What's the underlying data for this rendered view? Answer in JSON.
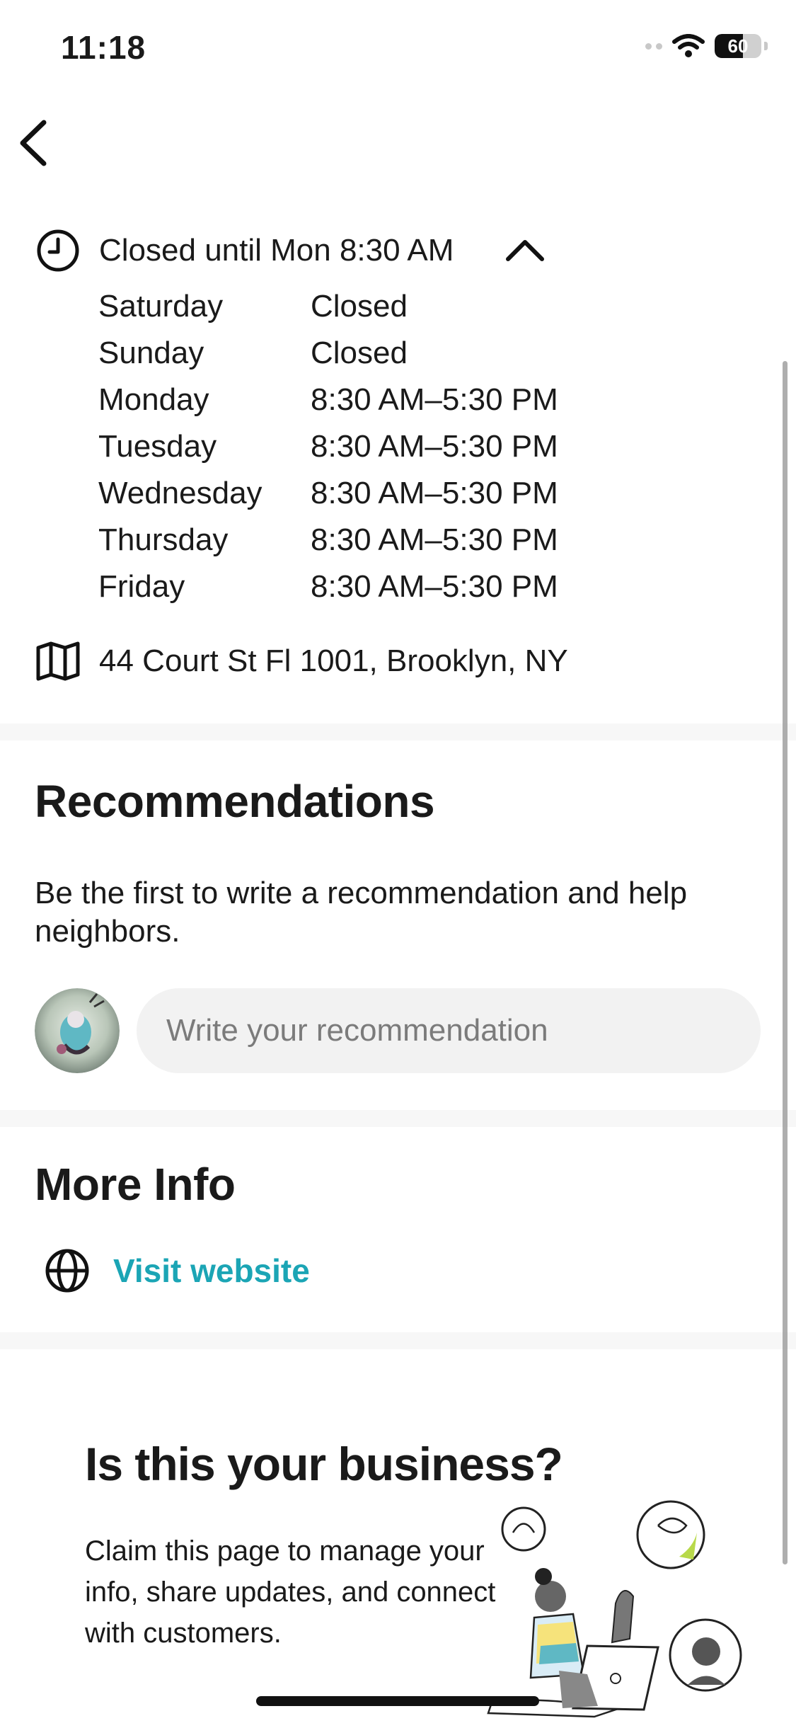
{
  "status": {
    "time": "11:18",
    "battery": "60",
    "battery_level": 0.6
  },
  "hours": {
    "summary": "Closed until Mon 8:30 AM",
    "rows": [
      {
        "day": "Saturday",
        "time": "Closed"
      },
      {
        "day": "Sunday",
        "time": "Closed"
      },
      {
        "day": "Monday",
        "time": "8:30 AM–5:30 PM"
      },
      {
        "day": "Tuesday",
        "time": "8:30 AM–5:30 PM"
      },
      {
        "day": "Wednesday",
        "time": "8:30 AM–5:30 PM"
      },
      {
        "day": "Thursday",
        "time": "8:30 AM–5:30 PM"
      },
      {
        "day": "Friday",
        "time": "8:30 AM–5:30 PM"
      }
    ]
  },
  "address": "44 Court St Fl 1001, Brooklyn, NY",
  "recommendations": {
    "title": "Recommendations",
    "text": "Be the first to write a recommendation and help neighbors.",
    "placeholder": "Write your recommendation"
  },
  "more_info": {
    "title": "More Info",
    "website_label": "Visit website"
  },
  "business": {
    "title": "Is this your business?",
    "text": "Claim this page to manage your info, share updates, and connect with customers."
  },
  "colors": {
    "accent": "#1ba5b5",
    "divider": "#f7f7f7",
    "input_bg": "#f2f2f2"
  },
  "icons": [
    "back-chevron-icon",
    "clock-icon",
    "chevron-up-icon",
    "map-icon",
    "globe-icon",
    "wifi-icon",
    "battery-icon"
  ]
}
